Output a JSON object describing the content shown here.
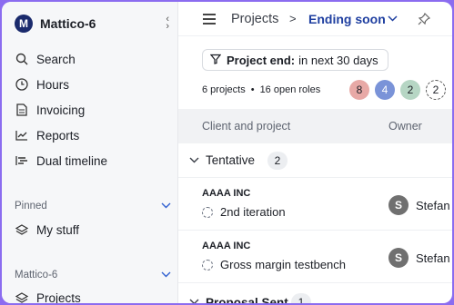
{
  "workspace": {
    "logo_letter": "M",
    "name": "Mattico-6"
  },
  "sidebar": {
    "nav": [
      {
        "label": "Search",
        "icon": "search-icon"
      },
      {
        "label": "Hours",
        "icon": "clock-icon"
      },
      {
        "label": "Invoicing",
        "icon": "document-icon"
      },
      {
        "label": "Reports",
        "icon": "chart-icon"
      },
      {
        "label": "Dual timeline",
        "icon": "timeline-icon"
      }
    ],
    "pinned": {
      "label": "Pinned",
      "items": [
        {
          "label": "My stuff",
          "icon": "layers-icon"
        }
      ]
    },
    "workspace_section": {
      "label": "Mattico-6",
      "items": [
        {
          "label": "Projects",
          "icon": "layers-icon"
        }
      ]
    }
  },
  "breadcrumb": {
    "parent": "Projects",
    "separator": ">",
    "current": "Ending soon"
  },
  "filter": {
    "label": "Project end:",
    "value": "in next 30 days"
  },
  "summary": {
    "projects": "6 projects",
    "dot": "•",
    "roles": "16 open roles"
  },
  "bubbles": [
    {
      "value": "8",
      "color": "#e8a9a6"
    },
    {
      "value": "4",
      "color": "#7a93d8"
    },
    {
      "value": "2",
      "color": "#b6d6c4"
    },
    {
      "value": "2",
      "color": "#ffffff"
    }
  ],
  "table": {
    "columns": [
      "Client and project",
      "Owner"
    ],
    "groups": [
      {
        "name": "Tentative",
        "count": "2",
        "rows": [
          {
            "client": "AAAA INC",
            "project": "2nd iteration",
            "owner_initial": "S",
            "owner": "Stefan"
          },
          {
            "client": "AAAA INC",
            "project": "Gross margin testbench",
            "owner_initial": "S",
            "owner": "Stefan"
          }
        ]
      },
      {
        "name": "Proposal Sent",
        "count": "1"
      }
    ]
  }
}
